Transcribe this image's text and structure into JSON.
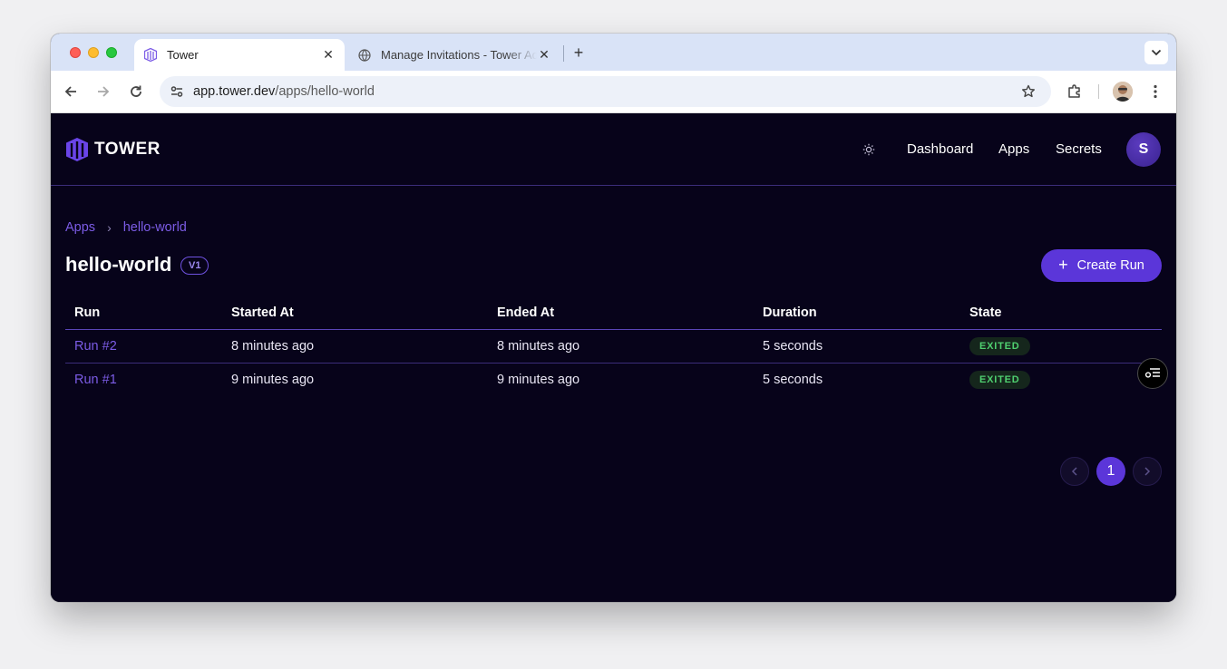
{
  "browser": {
    "tabs": [
      {
        "title": "Tower",
        "active": true
      },
      {
        "title": "Manage Invitations - Tower Admin",
        "active": false
      }
    ],
    "url_host": "app.tower.dev",
    "url_path": "/apps/hello-world"
  },
  "header": {
    "logo_text": "TOWER",
    "nav": {
      "dashboard": "Dashboard",
      "apps": "Apps",
      "secrets": "Secrets"
    },
    "user_initial": "S"
  },
  "breadcrumb": {
    "root": "Apps",
    "separator": "›",
    "current": "hello-world"
  },
  "page": {
    "title": "hello-world",
    "version": "V1",
    "create_run_label": "Create Run"
  },
  "table": {
    "columns": [
      "Run",
      "Started At",
      "Ended At",
      "Duration",
      "State"
    ],
    "rows": [
      {
        "run": "Run #2",
        "started": "8 minutes ago",
        "ended": "8 minutes ago",
        "duration": "5 seconds",
        "state": "EXITED"
      },
      {
        "run": "Run #1",
        "started": "9 minutes ago",
        "ended": "9 minutes ago",
        "duration": "5 seconds",
        "state": "EXITED"
      }
    ]
  },
  "pagination": {
    "current_page": "1",
    "prev_icon": "chevron-left-icon",
    "next_icon": "chevron-right-icon"
  },
  "colors": {
    "accent": "#5b36d9",
    "link": "#7c5ce6",
    "background": "#07031a",
    "state_exited": "#4fcf6f"
  }
}
